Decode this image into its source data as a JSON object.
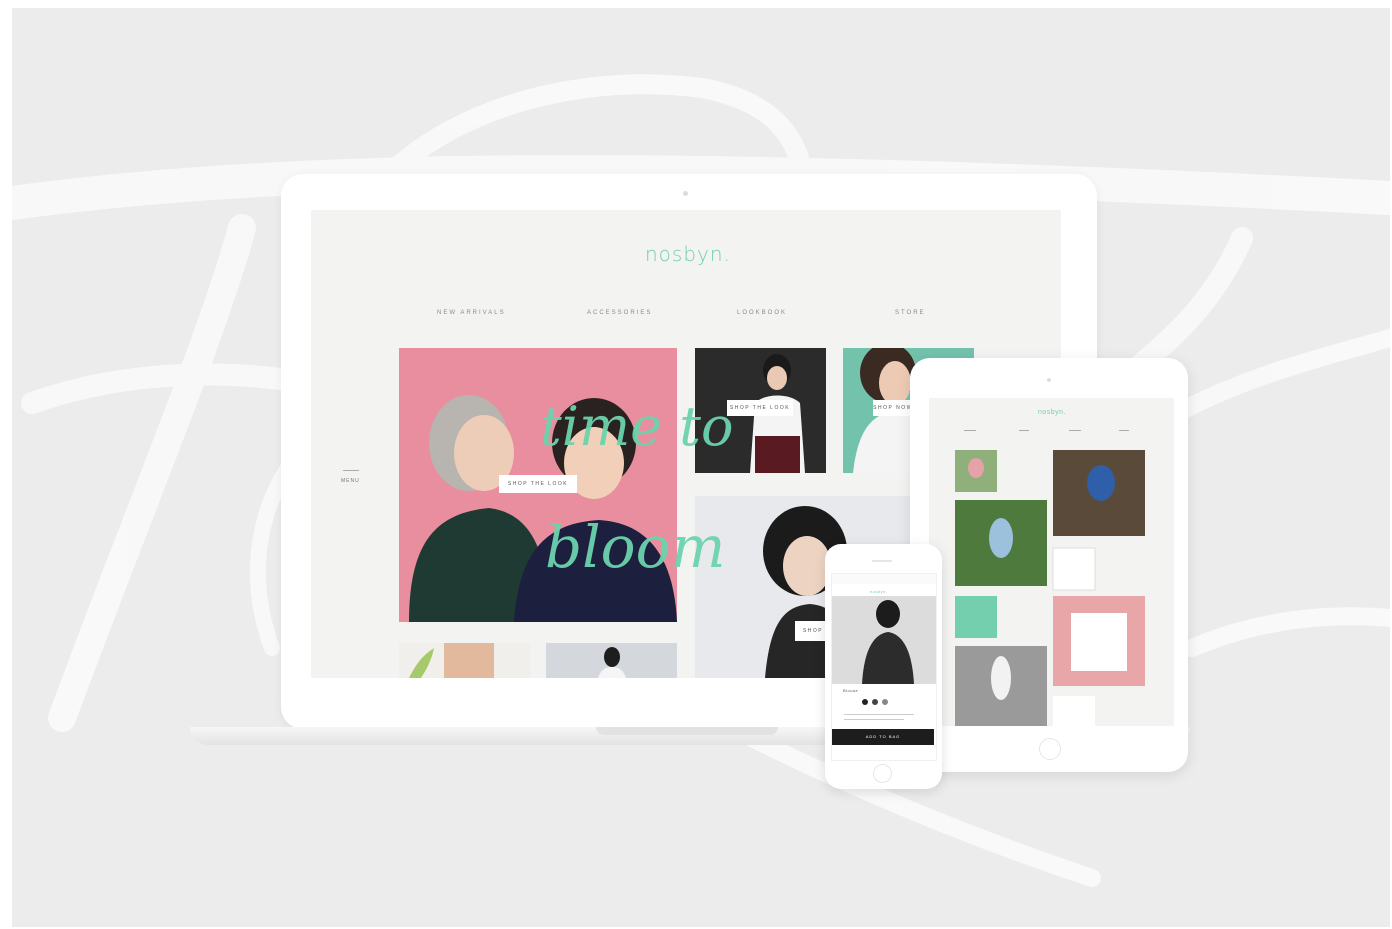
{
  "site": {
    "brand": "nosbyn.",
    "nav": [
      "NEW ARRIVALS",
      "ACCESSORIES",
      "LOOKBOOK",
      "STORE"
    ],
    "side_menu": "MENU",
    "hero_script": [
      "time to",
      "bloom"
    ],
    "tile_tags": [
      "SHOP THE LOOK",
      "SHOP THE LOOK",
      "SHOP NOW",
      "SHOP"
    ]
  },
  "tablet": {
    "brand": "nosbyn."
  },
  "phone": {
    "brand": "nosbyn.",
    "product_name": "Blouse",
    "add_button": "ADD TO BAG"
  },
  "colors": {
    "accent": "#74cfaf",
    "pink": "#e98e9e",
    "dark": "#1d1d1d"
  }
}
